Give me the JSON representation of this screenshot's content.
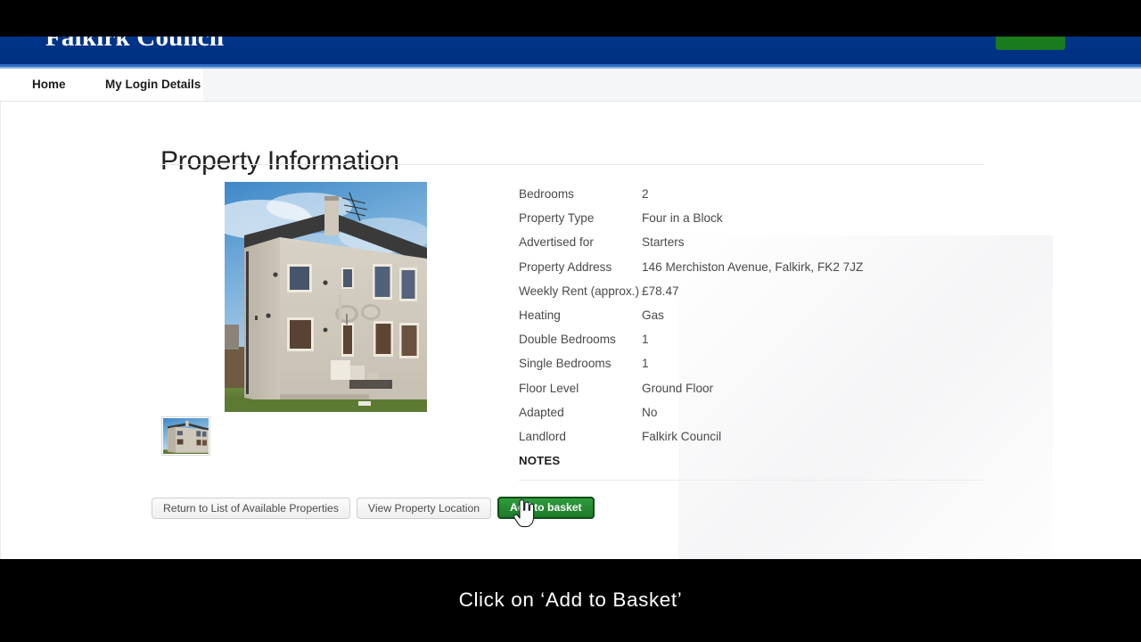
{
  "header": {
    "logo_text": "Falkirk Council",
    "cta_label": ""
  },
  "nav": {
    "items": [
      {
        "label": "Home"
      },
      {
        "label": "My Login Details"
      }
    ]
  },
  "main": {
    "page_title": "Property Information",
    "notes_heading": "NOTES",
    "photo_alt": "Photograph of two-storey four-in-a-block council house with roughcast walls, satellite dishes and grass garden",
    "thumbnail_alt": "Thumbnail of the same council house photograph",
    "details": [
      {
        "label": "Bedrooms",
        "value": "2"
      },
      {
        "label": "Property Type",
        "value": "Four in a Block"
      },
      {
        "label": "Advertised for",
        "value": "Starters"
      },
      {
        "label": "Property Address",
        "value": "146 Merchiston Avenue, Falkirk, FK2 7JZ"
      },
      {
        "label": "Weekly Rent (approx.)",
        "value": "£78.47"
      },
      {
        "label": "Heating",
        "value": "Gas"
      },
      {
        "label": "Double Bedrooms",
        "value": "1"
      },
      {
        "label": "Single Bedrooms",
        "value": "1"
      },
      {
        "label": "Floor Level",
        "value": "Ground Floor"
      },
      {
        "label": "Adapted",
        "value": "No"
      },
      {
        "label": "Landlord",
        "value": "Falkirk Council"
      }
    ],
    "buttons": {
      "return_label": "Return to List of Available Properties",
      "location_label": "View Property Location",
      "basket_label": "Add to basket"
    }
  },
  "caption": {
    "text": "Click on ‘Add to Basket’"
  },
  "colors": {
    "brand_blue": "#00338d",
    "accent_green": "#1e7a29",
    "letterbox": "#000000"
  }
}
